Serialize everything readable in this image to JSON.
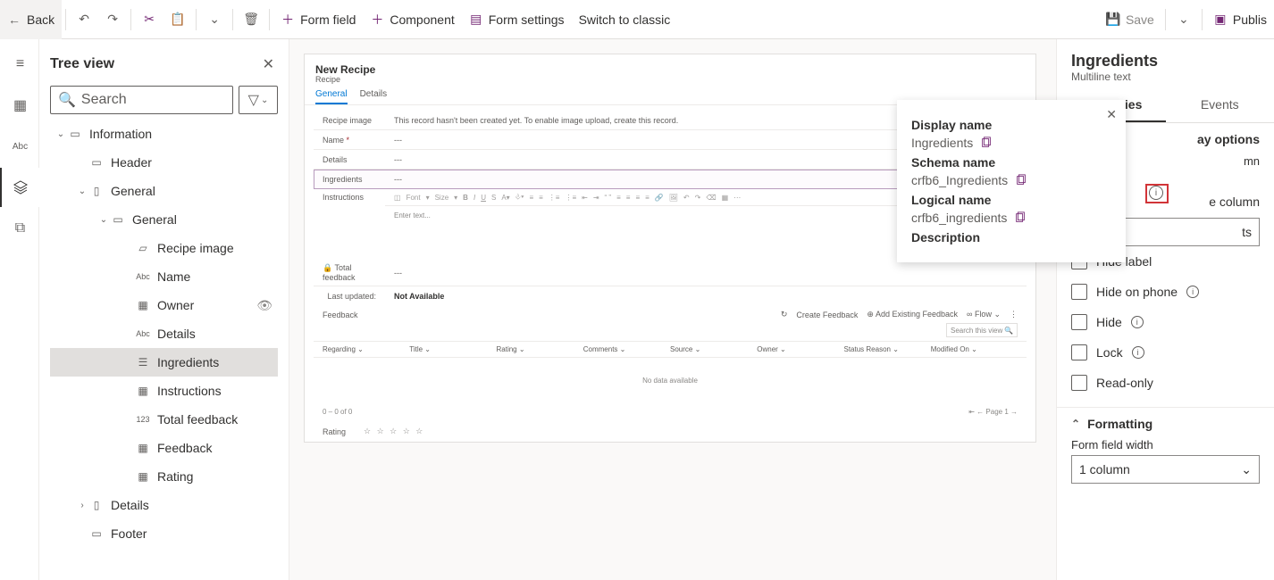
{
  "cmdbar": {
    "back": "Back",
    "form_field": "Form field",
    "component": "Component",
    "form_settings": "Form settings",
    "switch": "Switch to classic",
    "save": "Save",
    "publish": "Publis"
  },
  "tree": {
    "title": "Tree view",
    "search_placeholder": "Search",
    "nodes": {
      "information": "Information",
      "header": "Header",
      "general1": "General",
      "general2": "General",
      "recipe_image": "Recipe image",
      "name": "Name",
      "owner": "Owner",
      "details": "Details",
      "ingredients": "Ingredients",
      "instructions": "Instructions",
      "total_feedback": "Total feedback",
      "feedback": "Feedback",
      "rating": "Rating",
      "details2": "Details",
      "footer": "Footer"
    }
  },
  "form": {
    "title": "New Recipe",
    "subtitle": "Recipe",
    "tabs": {
      "general": "General",
      "details": "Details"
    },
    "rows": {
      "recipe_image": "Recipe image",
      "recipe_image_val": "This record hasn't been created yet. To enable image upload, create this record.",
      "name": "Name",
      "details": "Details",
      "ingredients": "Ingredients",
      "instructions": "Instructions",
      "font": "Font",
      "size": "Size",
      "enter_text": "Enter text...",
      "total_feedback": "Total feedback",
      "last_updated": "Last updated:",
      "not_available": "Not Available",
      "feedback": "Feedback",
      "create": "Create Feedback",
      "add_existing": "Add Existing Feedback",
      "flow": "Flow",
      "search_view": "Search this view",
      "cols": {
        "regarding": "Regarding",
        "title": "Title",
        "rating": "Rating",
        "comments": "Comments",
        "source": "Source",
        "owner": "Owner",
        "status": "Status Reason",
        "modified": "Modified On"
      },
      "nodata": "No data available",
      "page": "Page 1",
      "range": "0 – 0 of 0",
      "rating_label": "Rating"
    }
  },
  "popup": {
    "display_name_l": "Display name",
    "display_name_v": "Ingredients",
    "schema_l": "Schema name",
    "schema_v": "crfb6_Ingredients",
    "logical_l": "Logical name",
    "logical_v": "crfb6_ingredients",
    "desc_l": "Description"
  },
  "props": {
    "title": "Ingredients",
    "subtitle": "Multiline text",
    "tabs": {
      "properties": "Properties",
      "events": "Events"
    },
    "display_options": "ay options",
    "column_peek": "mn",
    "table_column": "e column",
    "textbox_peek": "ts",
    "checks": {
      "hide_label": "Hide label",
      "hide_phone": "Hide on phone",
      "hide": "Hide",
      "lock": "Lock",
      "readonly": "Read-only"
    },
    "formatting": "Formatting",
    "form_field_width": "Form field width",
    "width_value": "1 column"
  }
}
